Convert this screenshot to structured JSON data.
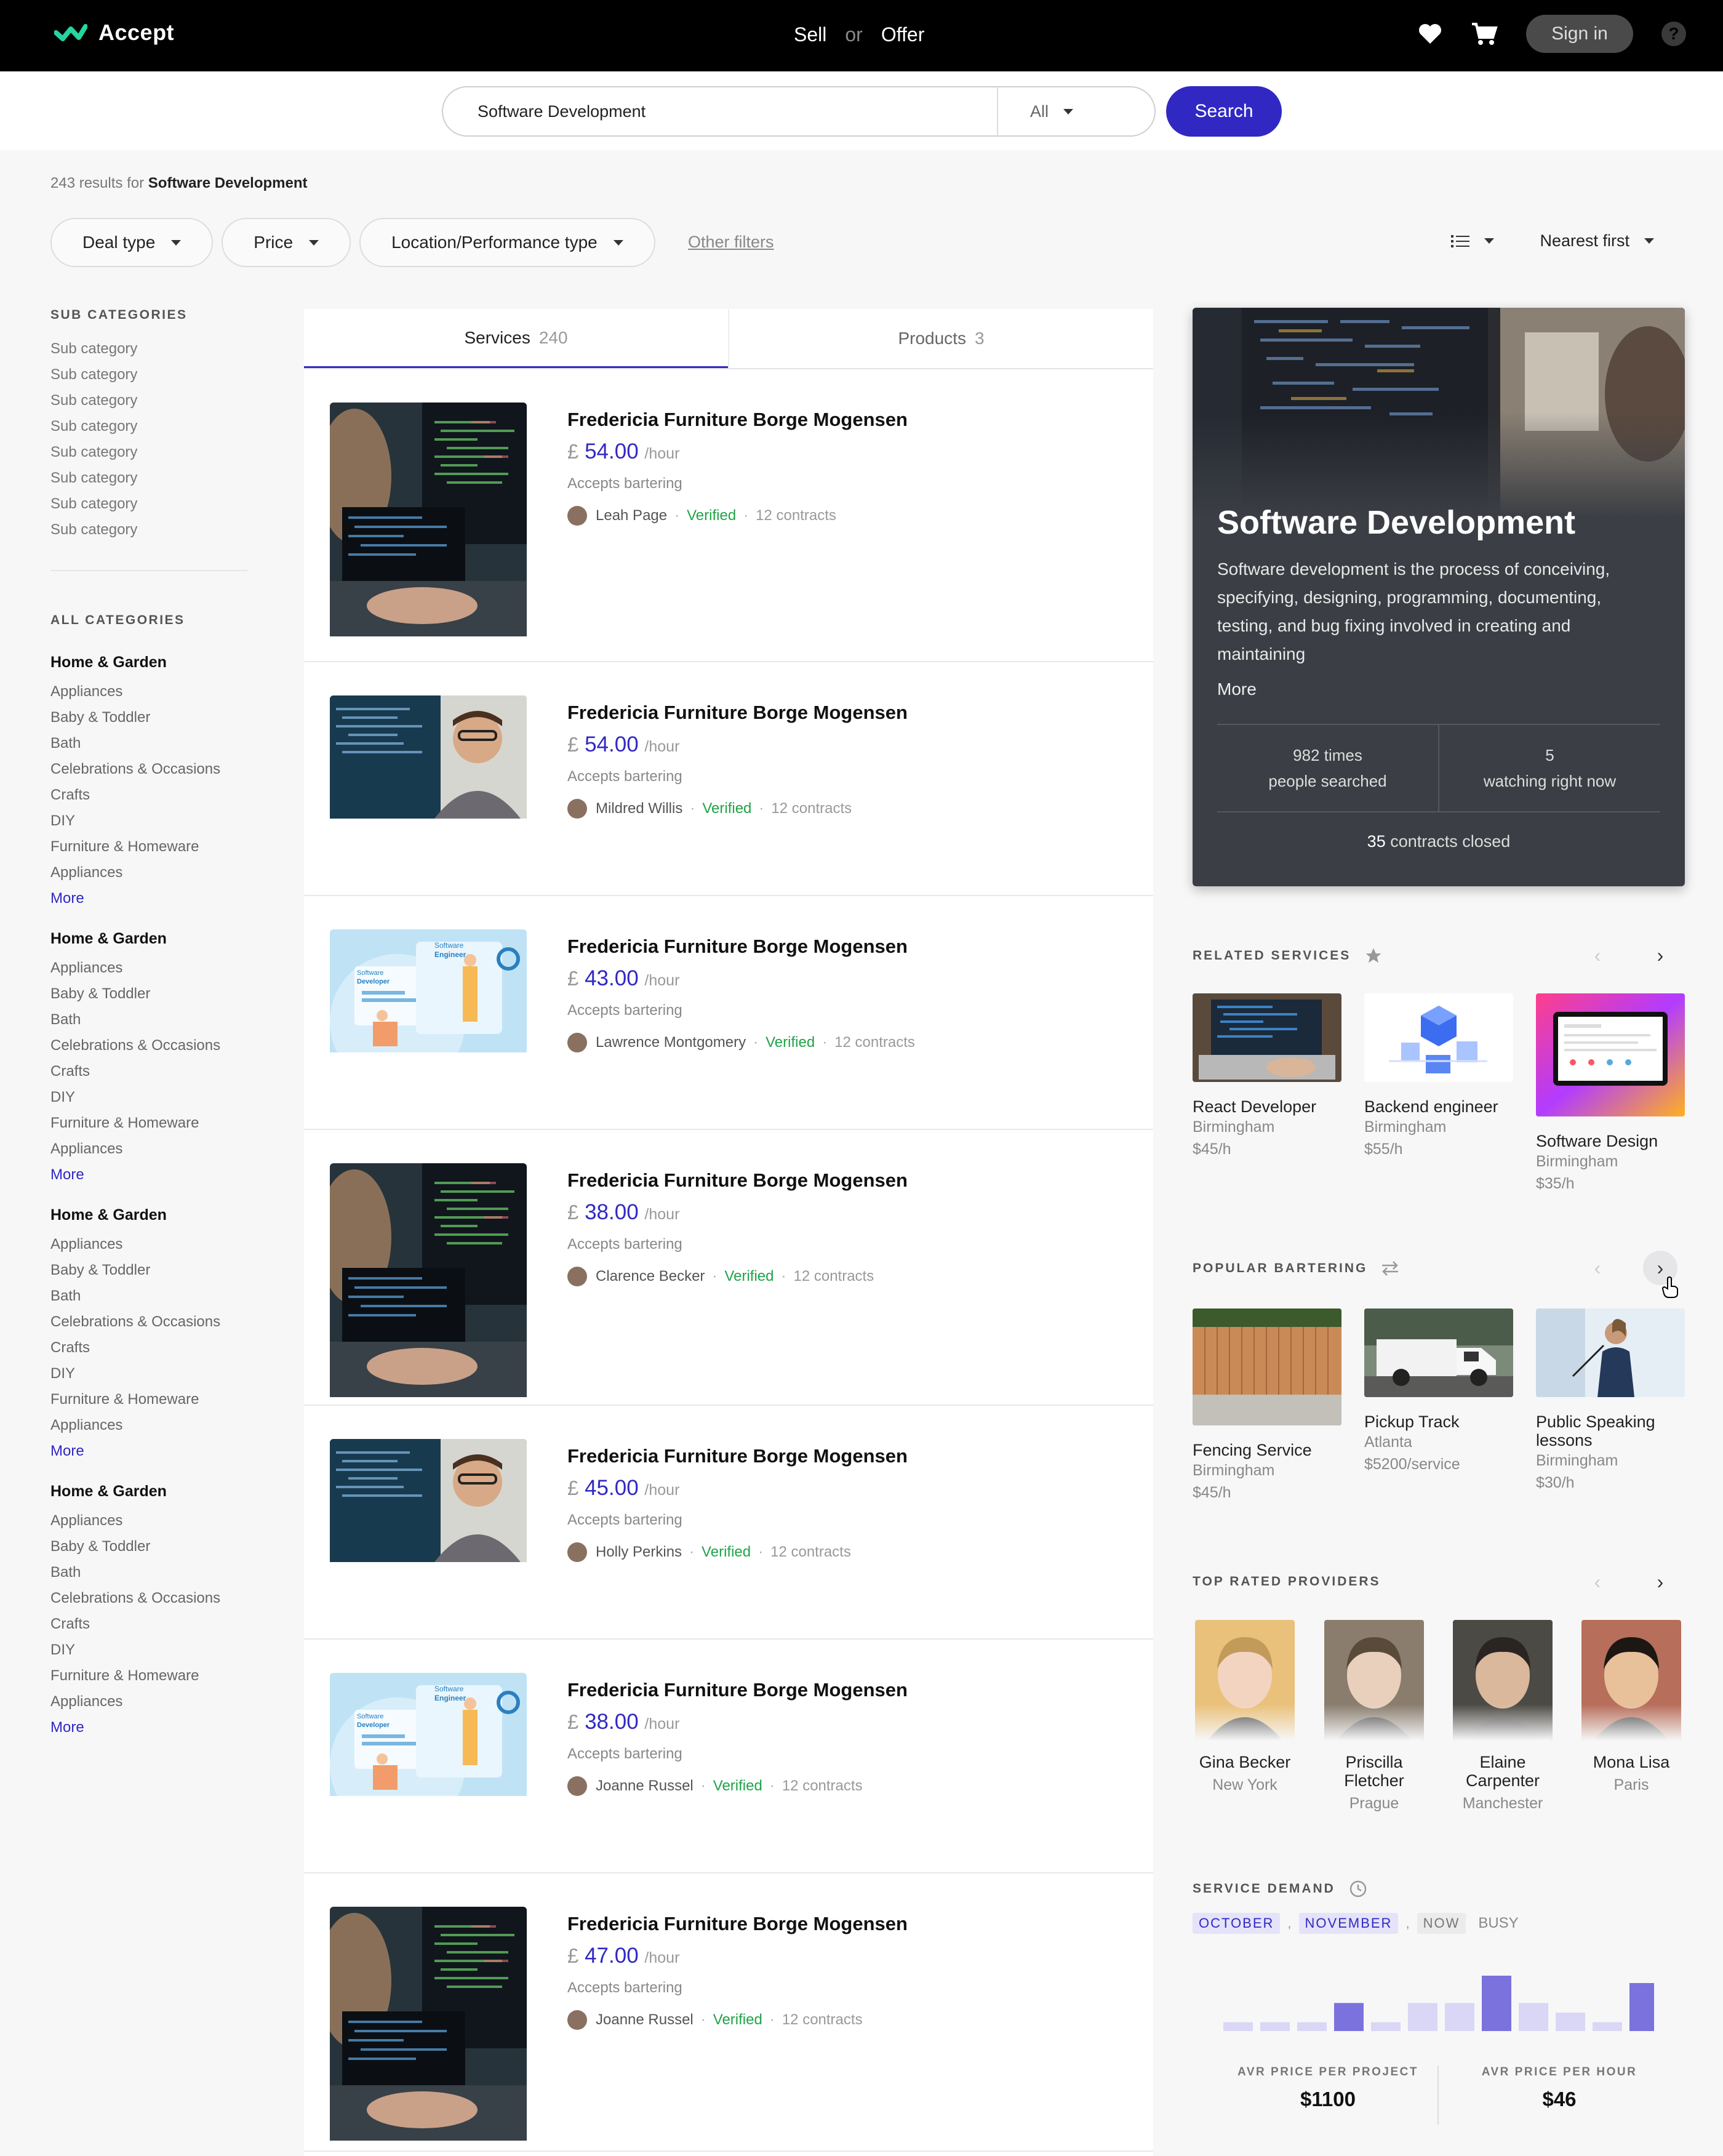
{
  "header": {
    "logo": "Accept",
    "sell": "Sell",
    "or": "or",
    "offer": "Offer",
    "sign_in": "Sign in",
    "help": "?"
  },
  "search": {
    "value": "Software Development",
    "category": "All",
    "button": "Search"
  },
  "results": {
    "count_text": "243 results for ",
    "query": "Software Development"
  },
  "filters": {
    "deal_type": "Deal type",
    "price": "Price",
    "location": "Location/Performance type",
    "other": "Other filters",
    "sort": "Nearest first"
  },
  "sidebar": {
    "sub_heading": "SUB CATEGORIES",
    "sub_items": [
      "Sub category",
      "Sub category",
      "Sub category",
      "Sub category",
      "Sub category",
      "Sub category",
      "Sub category",
      "Sub category"
    ],
    "all_heading": "ALL CATEGORIES",
    "groups": [
      {
        "title": "Home & Garden",
        "items": [
          "Appliances",
          "Baby & Toddler",
          "Bath",
          "Celebrations & Occasions",
          "Crafts",
          "DIY",
          "Furniture & Homeware",
          "Appliances"
        ],
        "more": "More"
      },
      {
        "title": "Home & Garden",
        "items": [
          "Appliances",
          "Baby & Toddler",
          "Bath",
          "Celebrations & Occasions",
          "Crafts",
          "DIY",
          "Furniture & Homeware",
          "Appliances"
        ],
        "more": "More"
      },
      {
        "title": "Home & Garden",
        "items": [
          "Appliances",
          "Baby & Toddler",
          "Bath",
          "Celebrations & Occasions",
          "Crafts",
          "DIY",
          "Furniture & Homeware",
          "Appliances"
        ],
        "more": "More"
      },
      {
        "title": "Home & Garden",
        "items": [
          "Appliances",
          "Baby & Toddler",
          "Bath",
          "Celebrations & Occasions",
          "Crafts",
          "DIY",
          "Furniture & Homeware",
          "Appliances"
        ],
        "more": "More"
      }
    ]
  },
  "tabs": [
    {
      "label": "Services",
      "count": "240"
    },
    {
      "label": "Products",
      "count": "3"
    }
  ],
  "listings": [
    {
      "title": "Fredericia Furniture Borge Mogensen",
      "currency": "£",
      "price": "54.00",
      "per": "/hour",
      "barter": "Accepts bartering",
      "user": "Leah Page",
      "verified": "Verified",
      "contracts": "12 contracts",
      "img": "code"
    },
    {
      "title": "Fredericia Furniture Borge Mogensen",
      "currency": "£",
      "price": "54.00",
      "per": "/hour",
      "barter": "Accepts bartering",
      "user": "Mildred Willis",
      "verified": "Verified",
      "contracts": "12 contracts",
      "img": "dev"
    },
    {
      "title": "Fredericia Furniture Borge Mogensen",
      "currency": "£",
      "price": "43.00",
      "per": "/hour",
      "barter": "Accepts bartering",
      "user": "Lawrence Montgomery",
      "verified": "Verified",
      "contracts": "12 contracts",
      "img": "illus"
    },
    {
      "title": "Fredericia Furniture Borge Mogensen",
      "currency": "£",
      "price": "38.00",
      "per": "/hour",
      "barter": "Accepts bartering",
      "user": "Clarence Becker",
      "verified": "Verified",
      "contracts": "12 contracts",
      "img": "code"
    },
    {
      "title": "Fredericia Furniture Borge Mogensen",
      "currency": "£",
      "price": "45.00",
      "per": "/hour",
      "barter": "Accepts bartering",
      "user": "Holly Perkins",
      "verified": "Verified",
      "contracts": "12 contracts",
      "img": "dev"
    },
    {
      "title": "Fredericia Furniture Borge Mogensen",
      "currency": "£",
      "price": "38.00",
      "per": "/hour",
      "barter": "Accepts bartering",
      "user": "Joanne Russel",
      "verified": "Verified",
      "contracts": "12 contracts",
      "img": "illus"
    },
    {
      "title": "Fredericia Furniture Borge Mogensen",
      "currency": "£",
      "price": "47.00",
      "per": "/hour",
      "barter": "Accepts bartering",
      "user": "Joanne Russel",
      "verified": "Verified",
      "contracts": "12 contracts",
      "img": "code"
    }
  ],
  "illus_text": {
    "a": "Software",
    "b": "Engineer",
    "c": "Software",
    "d": "Developer"
  },
  "hero": {
    "title": "Software Development",
    "description": "Software development is the process of conceiving, specifying, designing, programming, documenting, testing, and bug fixing involved in creating and maintaining",
    "more": "More",
    "stat1_value": "982 times",
    "stat1_label": "people searched",
    "stat2_value": "5",
    "stat2_label": "watching right now",
    "closed_count": "35",
    "closed_label": " contracts closed"
  },
  "related": {
    "heading": "RELATED SERVICES",
    "items": [
      {
        "name": "React Developer",
        "city": "Birmingham",
        "price": "$45/h"
      },
      {
        "name": "Backend engineer",
        "city": "Birmingham",
        "price": "$55/h"
      },
      {
        "name": "Software Design",
        "city": "Birmingham",
        "price": "$35/h"
      }
    ]
  },
  "bartering": {
    "heading": "POPULAR BARTERING",
    "items": [
      {
        "name": "Fencing Service",
        "city": "Birmingham",
        "price": "$45/h"
      },
      {
        "name": "Pickup Track",
        "city": "Atlanta",
        "price": "$5200/service"
      },
      {
        "name": "Public Speaking lessons",
        "city": "Birmingham",
        "price": "$30/h"
      }
    ]
  },
  "providers": {
    "heading": "TOP RATED PROVIDERS",
    "items": [
      {
        "name": "Gina Becker",
        "city": "New York"
      },
      {
        "name": "Priscilla Fletcher",
        "city": "Prague"
      },
      {
        "name": "Elaine Carpenter",
        "city": "Manchester"
      },
      {
        "name": "Mona Lisa",
        "city": "Paris"
      }
    ]
  },
  "demand": {
    "heading": "SERVICE DEMAND",
    "tags": [
      "OCTOBER",
      "NOVEMBER",
      "NOW"
    ],
    "busy": "BUSY",
    "bars": [
      0.12,
      0.12,
      0.12,
      0.38,
      0.12,
      0.38,
      0.38,
      0.75,
      0.38,
      0.25,
      0.12,
      0.65
    ],
    "highlight": [
      false,
      false,
      false,
      true,
      false,
      false,
      false,
      true,
      false,
      false,
      false,
      true
    ],
    "avg_project_label": "AVR PRICE PER PROJECT",
    "avg_project": "$1100",
    "avg_hour_label": "AVR PRICE PER HOUR",
    "avg_hour": "$46"
  },
  "colors": {
    "accent": "#3128c4",
    "verified": "#21a349",
    "topbar": "#000000",
    "hero": "#3b3e44"
  }
}
